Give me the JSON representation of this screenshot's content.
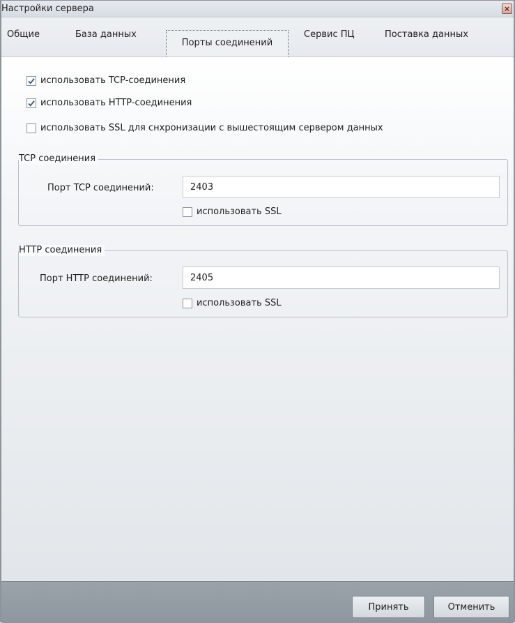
{
  "window": {
    "title": "Настройки сервера",
    "close_icon": "close-icon"
  },
  "tabs": [
    {
      "label": "Общие",
      "active": false
    },
    {
      "label": "База данных",
      "active": false
    },
    {
      "label": "Порты соединений",
      "active": true
    },
    {
      "label": "Сервис ПЦ",
      "active": false
    },
    {
      "label": "Поставка данных",
      "active": false
    }
  ],
  "options": [
    {
      "label": "использовать TCP-соединения",
      "checked": true
    },
    {
      "label": "использовать HTTP-соединения",
      "checked": true
    },
    {
      "label": "использовать SSL для снхронизации с вышестоящим сервером данных",
      "checked": false
    }
  ],
  "tcp_group": {
    "title": "TCP соединения",
    "port_label": "Порт TCP соединений:",
    "port_value": "2403",
    "ssl_label": "использовать SSL",
    "ssl_checked": false
  },
  "http_group": {
    "title": "HTTP соединения",
    "port_label": "Порт HTTP соединений:",
    "port_value": "2405",
    "ssl_label": "использовать SSL",
    "ssl_checked": false
  },
  "footer": {
    "accept_label": "Принять",
    "cancel_label": "Отменить"
  },
  "colors": {
    "check_mark": "#3f5f86",
    "footer_bg": "#959da5"
  }
}
